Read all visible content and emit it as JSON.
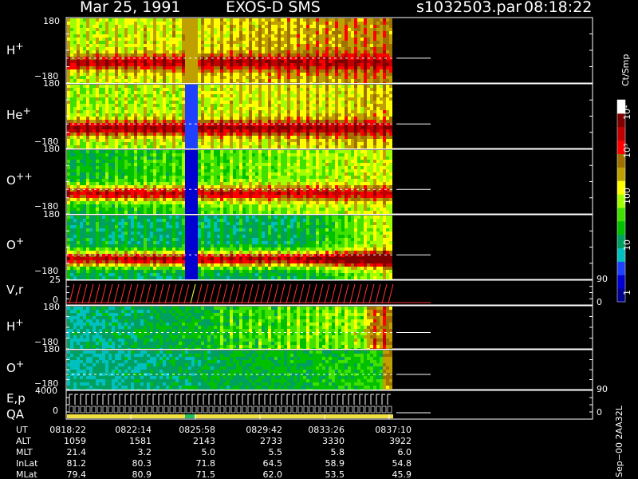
{
  "header": {
    "date": "Mar 25, 1991",
    "instrument": "EXOS-D SMS",
    "file": "s1032503.par",
    "time": "08:18:22"
  },
  "panels": [
    {
      "id": "h",
      "label": "H",
      "sup": "+",
      "y_top": "180",
      "y_bottom": "−180",
      "type": "spectrogram",
      "profile": "h"
    },
    {
      "id": "he",
      "label": "He",
      "sup": "+",
      "y_top": "180",
      "y_bottom": "−180",
      "type": "spectrogram",
      "profile": "he"
    },
    {
      "id": "opp",
      "label": "O",
      "sup": "++",
      "y_top": "180",
      "y_bottom": "−180",
      "type": "spectrogram",
      "profile": "opp"
    },
    {
      "id": "o",
      "label": "O",
      "sup": "+",
      "y_top": "180",
      "y_bottom": "−180",
      "type": "spectrogram",
      "profile": "o"
    },
    {
      "id": "vr",
      "label": "V,r",
      "sup": "",
      "y_top": "25",
      "y_bottom": "0",
      "right_top": "90",
      "right_bottom": "0",
      "type": "line"
    },
    {
      "id": "h2",
      "label": "H",
      "sup": "+",
      "y_top": "180",
      "y_bottom": "−180",
      "type": "spectrogram",
      "profile": "h2"
    },
    {
      "id": "o2",
      "label": "O",
      "sup": "+",
      "y_top": "180",
      "y_bottom": "−180",
      "type": "spectrogram",
      "profile": "o2"
    },
    {
      "id": "ep",
      "label": "E,p",
      "label2": "QA",
      "sup": "",
      "y_top": "4000",
      "y_bottom": "0",
      "right_top": "90",
      "right_bottom": "0",
      "type": "line"
    }
  ],
  "colorbar": {
    "unit": "Ct/Smp",
    "tick_labels": [
      "10⁴",
      "10³",
      "100",
      "10",
      "1"
    ],
    "tick_values": [
      10000,
      1000,
      100,
      10,
      1
    ],
    "range": [
      1,
      20000
    ],
    "colors": [
      "#000090",
      "#0000d0",
      "#2040ff",
      "#00c0c0",
      "#00a060",
      "#00c000",
      "#40e000",
      "#a0ff00",
      "#ffff00",
      "#c0a000",
      "#a07000",
      "#ff0000",
      "#c00000",
      "#800000",
      "#ffffff"
    ]
  },
  "footer": {
    "labels": [
      "UT",
      "ALT",
      "MLT",
      "InLat",
      "MLat"
    ],
    "columns": [
      {
        "UT": "0818:22",
        "ALT": "1059",
        "MLT": "21.4",
        "InLat": "81.2",
        "MLat": "79.4"
      },
      {
        "UT": "0822:14",
        "ALT": "1581",
        "MLT": "3.2",
        "InLat": "80.3",
        "MLat": "80.9"
      },
      {
        "UT": "0825:58",
        "ALT": "2143",
        "MLT": "5.0",
        "InLat": "71.8",
        "MLat": "71.5"
      },
      {
        "UT": "0829:42",
        "ALT": "2733",
        "MLT": "5.5",
        "InLat": "64.5",
        "MLat": "62.0"
      },
      {
        "UT": "0833:26",
        "ALT": "3330",
        "MLT": "5.8",
        "InLat": "58.9",
        "MLat": "53.5"
      },
      {
        "UT": "0837:10",
        "ALT": "3922",
        "MLT": "6.0",
        "InLat": "54.8",
        "MLat": "45.9"
      }
    ],
    "side_text": "Sep−00  2AA32L"
  },
  "chart_data": {
    "type": "heatmap",
    "title": "Mar 25, 1991   EXOS-D SMS",
    "x_ticks": [
      "0818:22",
      "0822:14",
      "0825:58",
      "0829:42",
      "0833:26",
      "0837:10"
    ],
    "y_range": [
      -180,
      180
    ],
    "series": [
      {
        "name": "H+"
      },
      {
        "name": "He+"
      },
      {
        "name": "O++"
      },
      {
        "name": "O+"
      },
      {
        "name": "V,r"
      },
      {
        "name": "H+"
      },
      {
        "name": "O+"
      },
      {
        "name": "E,p"
      }
    ],
    "color_unit": "Ct/Smp",
    "color_scale": "log"
  }
}
